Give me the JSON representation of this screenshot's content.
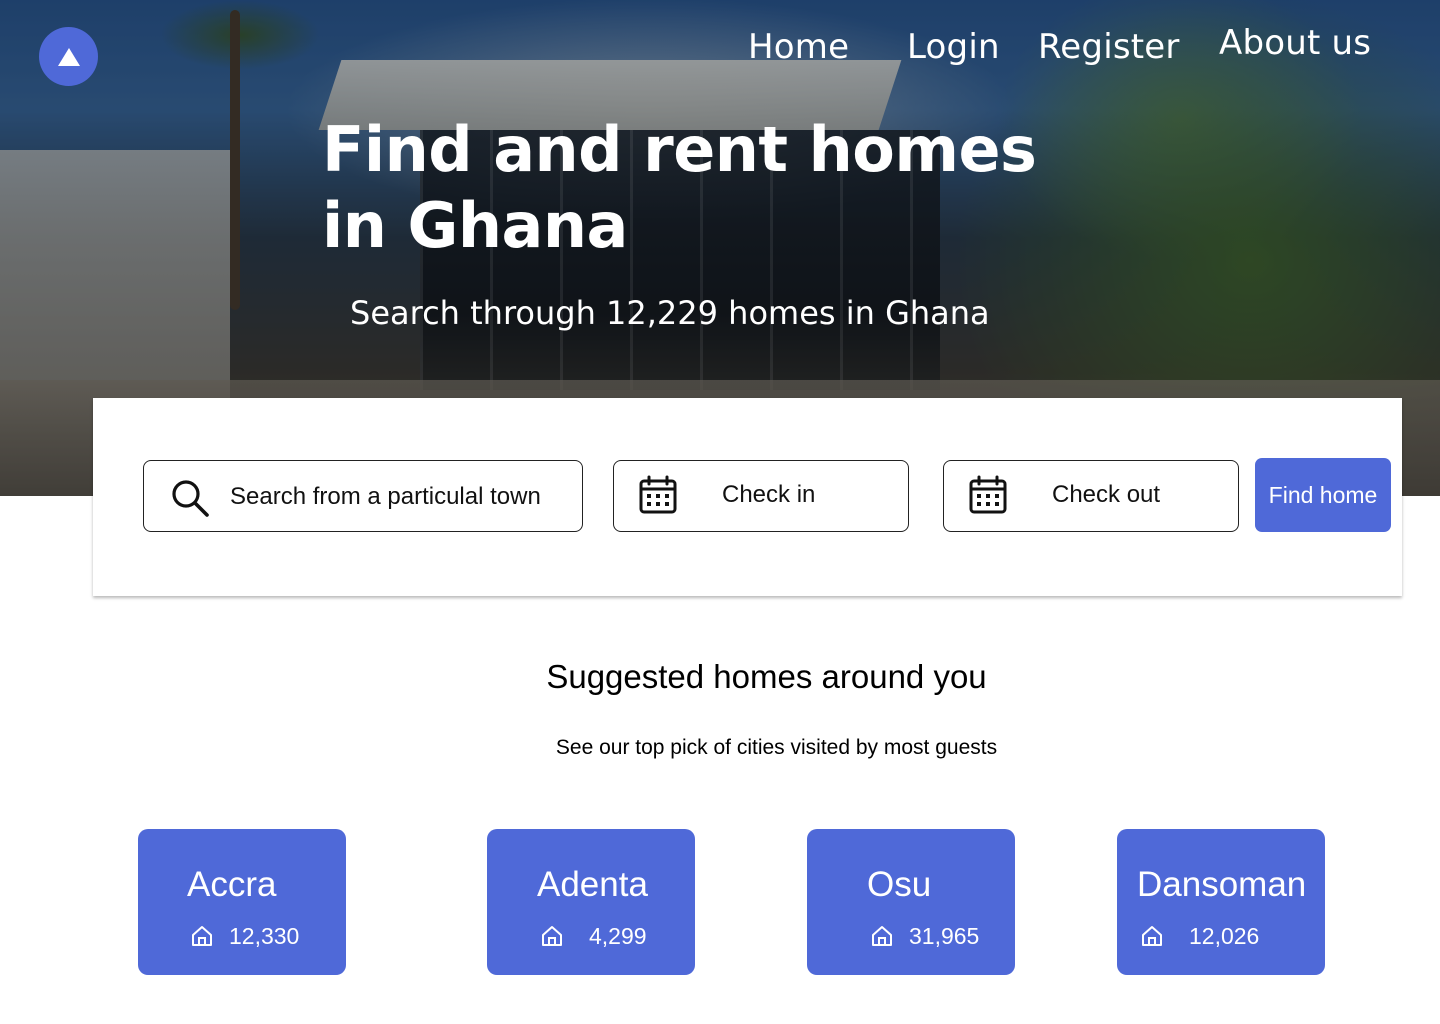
{
  "colors": {
    "accent": "#4f69d8",
    "text": "#000000",
    "hero_text": "#ffffff"
  },
  "nav": {
    "logo_icon": "triangle-up-icon",
    "links": [
      "Home",
      "Login",
      "Register",
      "About us"
    ]
  },
  "hero": {
    "title": "Find and rent homes in Ghana",
    "subtitle": "Search through 12,229 homes in Ghana"
  },
  "search": {
    "town_placeholder": "Search from a particulal town",
    "town_icon": "search-icon",
    "checkin_placeholder": "Check in",
    "checkout_placeholder": "Check out",
    "calendar_icon": "calendar-icon",
    "button_label": "Find home"
  },
  "suggestions": {
    "title": "Suggested homes around you",
    "subtitle": "See our top pick of cities visited by most guests",
    "count_icon": "home-icon",
    "cities": [
      {
        "name": "Accra",
        "count": "12,330"
      },
      {
        "name": "Adenta",
        "count": "4,299"
      },
      {
        "name": "Osu",
        "count": "31,965"
      },
      {
        "name": "Dansoman",
        "count": "12,026"
      }
    ]
  }
}
